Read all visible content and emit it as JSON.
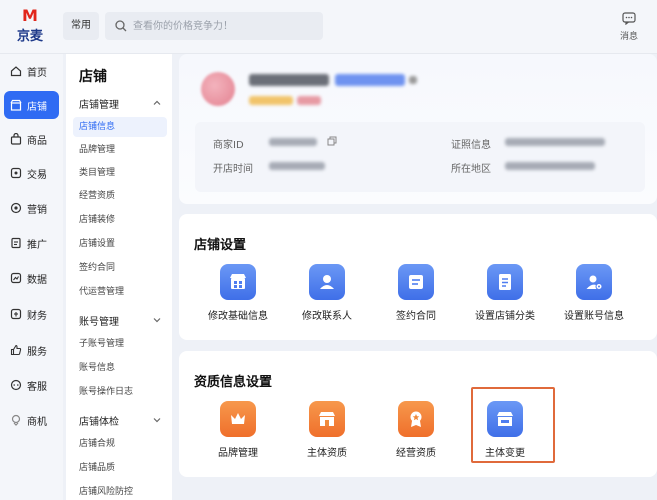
{
  "brand": {
    "mark_left": "M",
    "name": "京麦"
  },
  "header": {
    "common_label": "常用",
    "search_placeholder": "查看你的价格竞争力！",
    "message_label": "消息"
  },
  "left_nav": [
    {
      "label": "首页",
      "icon": "home-icon"
    },
    {
      "label": "店铺",
      "icon": "store-icon",
      "active": true
    },
    {
      "label": "商品",
      "icon": "bag-icon"
    },
    {
      "label": "交易",
      "icon": "trade-icon"
    },
    {
      "label": "营销",
      "icon": "marketing-icon"
    },
    {
      "label": "推广",
      "icon": "promotion-icon"
    },
    {
      "label": "数据",
      "icon": "data-icon"
    },
    {
      "label": "财务",
      "icon": "finance-icon"
    },
    {
      "label": "服务",
      "icon": "thumbs-up-icon"
    },
    {
      "label": "客服",
      "icon": "service-chat-icon"
    },
    {
      "label": "商机",
      "icon": "opportunity-icon"
    }
  ],
  "sub_nav": {
    "title": "店铺",
    "groups": [
      {
        "label": "店铺管理",
        "items": [
          "店铺信息",
          "品牌管理",
          "类目管理",
          "经营资质",
          "店铺装修",
          "店铺设置",
          "签约合同",
          "代运营管理"
        ]
      },
      {
        "label": "账号管理",
        "items": [
          "子账号管理",
          "账号信息",
          "账号操作日志"
        ]
      },
      {
        "label": "店铺体检",
        "items": [
          "店铺合规",
          "店铺品质",
          "店铺风险防控"
        ]
      }
    ],
    "active_item": "店铺信息"
  },
  "profile": {
    "merchant_id_label": "商家ID",
    "open_time_label": "开店时间",
    "license_label": "证照信息",
    "region_label": "所在地区"
  },
  "store_settings": {
    "title": "店铺设置",
    "tiles": [
      {
        "label": "修改基础信息",
        "icon": "store-grid-icon",
        "color": "blue"
      },
      {
        "label": "修改联系人",
        "icon": "contact-person-icon",
        "color": "blue"
      },
      {
        "label": "签约合同",
        "icon": "contract-icon",
        "color": "blue"
      },
      {
        "label": "设置店铺分类",
        "icon": "category-doc-icon",
        "color": "blue"
      },
      {
        "label": "设置账号信息",
        "icon": "account-settings-icon",
        "color": "blue"
      }
    ]
  },
  "qualification_settings": {
    "title": "资质信息设置",
    "tiles": [
      {
        "label": "品牌管理",
        "icon": "crown-icon",
        "color": "orange"
      },
      {
        "label": "主体资质",
        "icon": "shop-front-icon",
        "color": "orange"
      },
      {
        "label": "经营资质",
        "icon": "medal-icon",
        "color": "orange"
      },
      {
        "label": "主体变更",
        "icon": "store-change-icon",
        "color": "blue"
      }
    ]
  },
  "colors": {
    "accent": "#2f6bf3",
    "orange": "#ef6f2b",
    "highlight_box": "#e06a3b"
  }
}
